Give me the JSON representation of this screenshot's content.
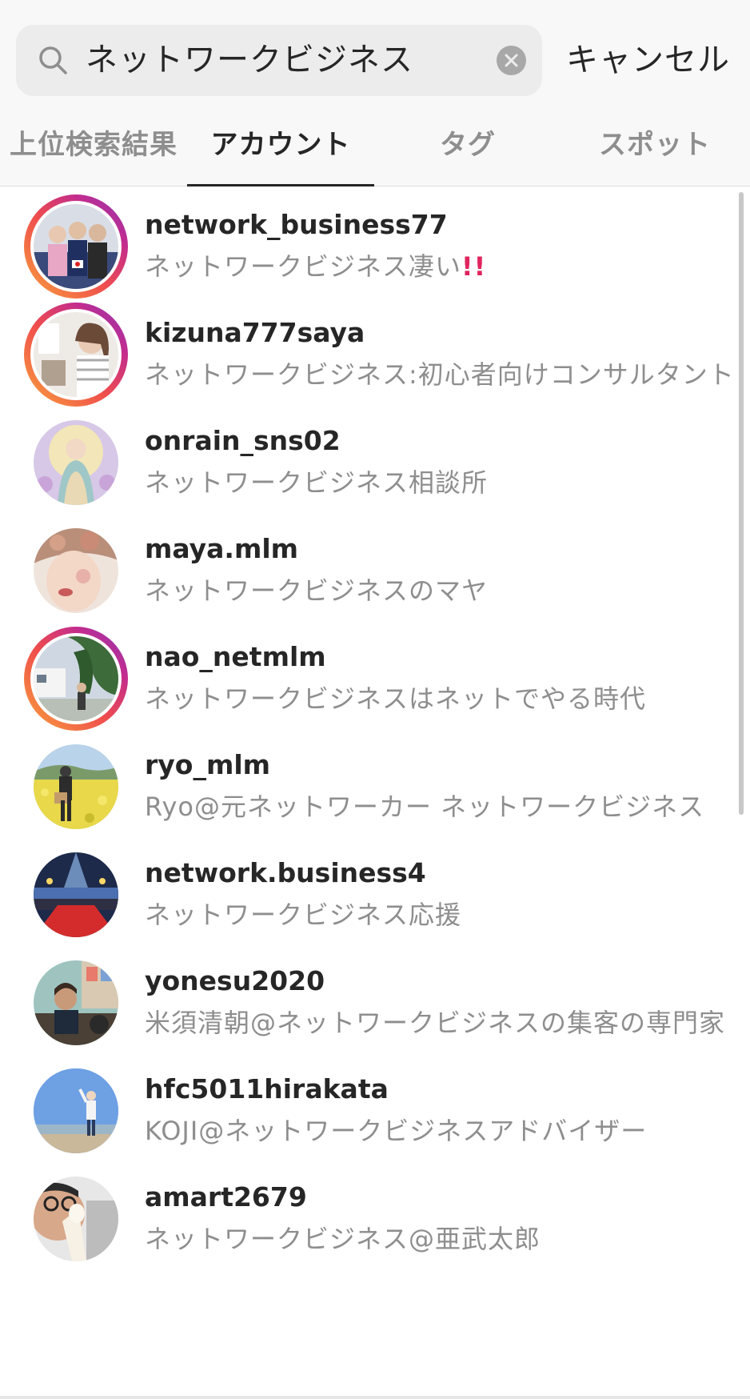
{
  "search": {
    "query": "ネットワークビジネス",
    "cancel_label": "キャンセル"
  },
  "tabs": [
    {
      "label": "上位検索結果",
      "active": false
    },
    {
      "label": "アカウント",
      "active": true
    },
    {
      "label": "タグ",
      "active": false
    },
    {
      "label": "スポット",
      "active": false
    }
  ],
  "accounts": [
    {
      "username": "network_business77",
      "subtitle": "ネットワークビジネス凄い",
      "badge": "!!",
      "story_ring": true
    },
    {
      "username": "kizuna777saya",
      "subtitle": "ネットワークビジネス:初心者向けコンサルタント",
      "story_ring": true
    },
    {
      "username": "onrain_sns02",
      "subtitle": "ネットワークビジネス相談所",
      "story_ring": false
    },
    {
      "username": "maya.mlm",
      "subtitle": "ネットワークビジネスのマヤ",
      "story_ring": false
    },
    {
      "username": "nao_netmlm",
      "subtitle": "ネットワークビジネスはネットでやる時代",
      "story_ring": true
    },
    {
      "username": "ryo_mlm",
      "subtitle": "Ryo@元ネットワーカー ネットワークビジネス",
      "story_ring": false
    },
    {
      "username": "network.business4",
      "subtitle": "ネットワークビジネス応援",
      "story_ring": false
    },
    {
      "username": "yonesu2020",
      "subtitle": "米須清朝@ネットワークビジネスの集客の専門家",
      "story_ring": false
    },
    {
      "username": "hfc5011hirakata",
      "subtitle": "KOJI@ネットワークビジネスアドバイザー",
      "story_ring": false
    },
    {
      "username": "amart2679",
      "subtitle": "ネットワークビジネス@亜武太郎",
      "story_ring": false
    }
  ],
  "colors": {
    "text_primary": "#262626",
    "text_secondary": "#8e8e8e",
    "badge_red": "#e0245e",
    "story_ring_gradient": [
      "#f9a33b",
      "#ef4d4d",
      "#c32c8d",
      "#8a3ab9"
    ]
  }
}
